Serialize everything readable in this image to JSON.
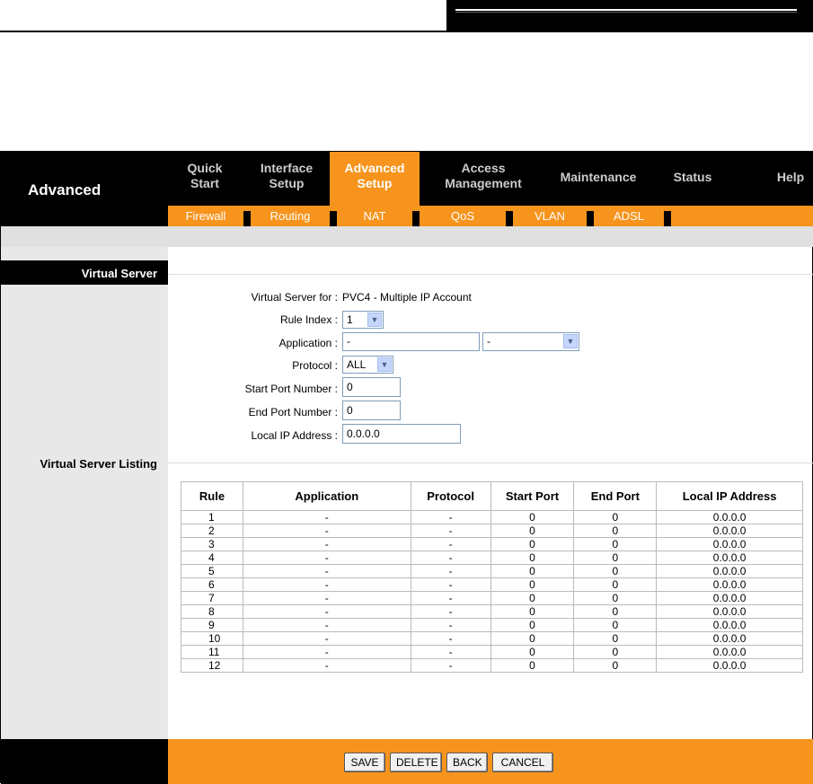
{
  "brand": "Advanced",
  "nav_tabs": [
    {
      "line1": "Quick",
      "line2": "Start"
    },
    {
      "line1": "Interface",
      "line2": "Setup"
    },
    {
      "line1": "Advanced",
      "line2": "Setup"
    },
    {
      "line1": "Access",
      "line2": "Management"
    },
    {
      "line1": "Maintenance",
      "line2": ""
    },
    {
      "line1": "Status",
      "line2": ""
    },
    {
      "line1": "Help",
      "line2": ""
    }
  ],
  "active_tab": "Advanced Setup",
  "sub_tabs": [
    "Firewall",
    "Routing",
    "NAT",
    "QoS",
    "VLAN",
    "ADSL"
  ],
  "section_virtual_server": "Virtual Server",
  "section_listing": "Virtual Server Listing",
  "form": {
    "virtual_server_for_label": "Virtual Server for :",
    "virtual_server_for_value": "PVC4 - Multiple IP Account",
    "rule_index_label": "Rule Index :",
    "rule_index_value": "1",
    "application_label": "Application :",
    "application_value": "-",
    "application_select_value": "-",
    "protocol_label": "Protocol :",
    "protocol_value": "ALL",
    "start_port_label": "Start Port Number :",
    "start_port_value": "0",
    "end_port_label": "End Port Number :",
    "end_port_value": "0",
    "local_ip_label": "Local IP Address :",
    "local_ip_value": "0.0.0.0"
  },
  "table": {
    "headers": [
      "Rule",
      "Application",
      "Protocol",
      "Start Port",
      "End Port",
      "Local IP Address"
    ],
    "rows": [
      [
        "1",
        "-",
        "-",
        "0",
        "0",
        "0.0.0.0"
      ],
      [
        "2",
        "-",
        "-",
        "0",
        "0",
        "0.0.0.0"
      ],
      [
        "3",
        "-",
        "-",
        "0",
        "0",
        "0.0.0.0"
      ],
      [
        "4",
        "-",
        "-",
        "0",
        "0",
        "0.0.0.0"
      ],
      [
        "5",
        "-",
        "-",
        "0",
        "0",
        "0.0.0.0"
      ],
      [
        "6",
        "-",
        "-",
        "0",
        "0",
        "0.0.0.0"
      ],
      [
        "7",
        "-",
        "-",
        "0",
        "0",
        "0.0.0.0"
      ],
      [
        "8",
        "-",
        "-",
        "0",
        "0",
        "0.0.0.0"
      ],
      [
        "9",
        "-",
        "-",
        "0",
        "0",
        "0.0.0.0"
      ],
      [
        "10",
        "-",
        "-",
        "0",
        "0",
        "0.0.0.0"
      ],
      [
        "11",
        "-",
        "-",
        "0",
        "0",
        "0.0.0.0"
      ],
      [
        "12",
        "-",
        "-",
        "0",
        "0",
        "0.0.0.0"
      ]
    ]
  },
  "buttons": {
    "save": "SAVE",
    "delete": "DELETE",
    "back": "BACK",
    "cancel": "CANCEL"
  },
  "colors": {
    "accent": "#f7941d",
    "nav_bg": "#000000",
    "band_gray": "#e0e0e0"
  }
}
